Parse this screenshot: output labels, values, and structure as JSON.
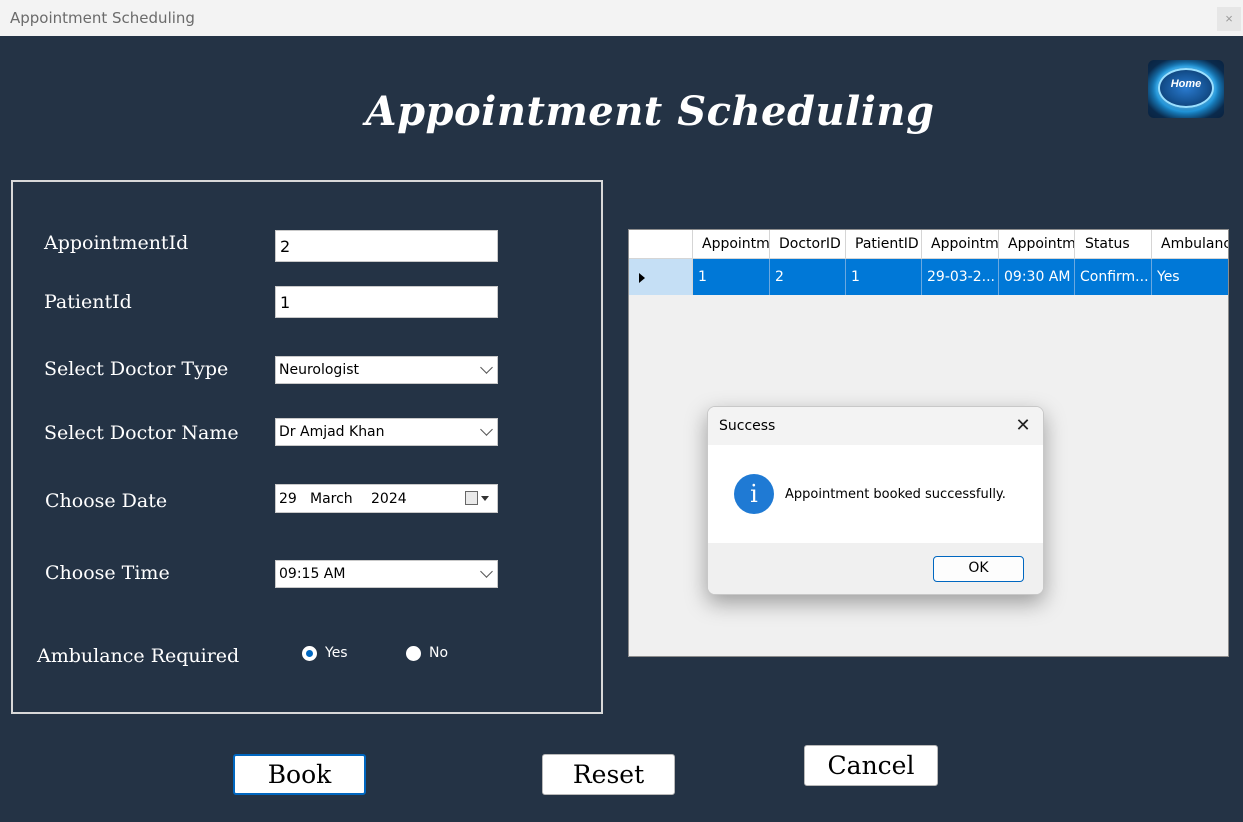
{
  "window": {
    "title": "Appointment Scheduling",
    "close_glyph": "×"
  },
  "page": {
    "title": "Appointment Scheduling",
    "home_label": "Home"
  },
  "form": {
    "appointment_id_label": "AppointmentId",
    "appointment_id_value": "2",
    "patient_id_label": "PatientId",
    "patient_id_value": "1",
    "doctor_type_label": "Select Doctor Type",
    "doctor_type_value": "Neurologist",
    "doctor_name_label": "Select Doctor Name",
    "doctor_name_value": "Dr Amjad Khan",
    "date_label": "Choose Date",
    "date_day": "29",
    "date_month": "March",
    "date_year": "2024",
    "time_label": "Choose Time",
    "time_value": "09:15 AM",
    "ambulance_label": "Ambulance Required",
    "ambulance_yes": "Yes",
    "ambulance_no": "No",
    "ambulance_selected": "Yes"
  },
  "grid": {
    "columns": [
      "Appointm",
      "DoctorID",
      "PatientID",
      "Appointm",
      "Appointm",
      "Status",
      "Ambulanc"
    ],
    "rows": [
      [
        "1",
        "2",
        "1",
        "29-03-2...",
        "09:30 AM",
        "Confirm...",
        "Yes"
      ]
    ]
  },
  "dialog": {
    "title": "Success",
    "message": "Appointment booked successfully.",
    "ok_label": "OK",
    "icon": "info-icon"
  },
  "actions": {
    "book_label": "Book",
    "reset_label": "Reset",
    "cancel_label": "Cancel"
  },
  "colors": {
    "background": "#243345",
    "selection": "#0078d7",
    "accent": "#0067c0"
  }
}
